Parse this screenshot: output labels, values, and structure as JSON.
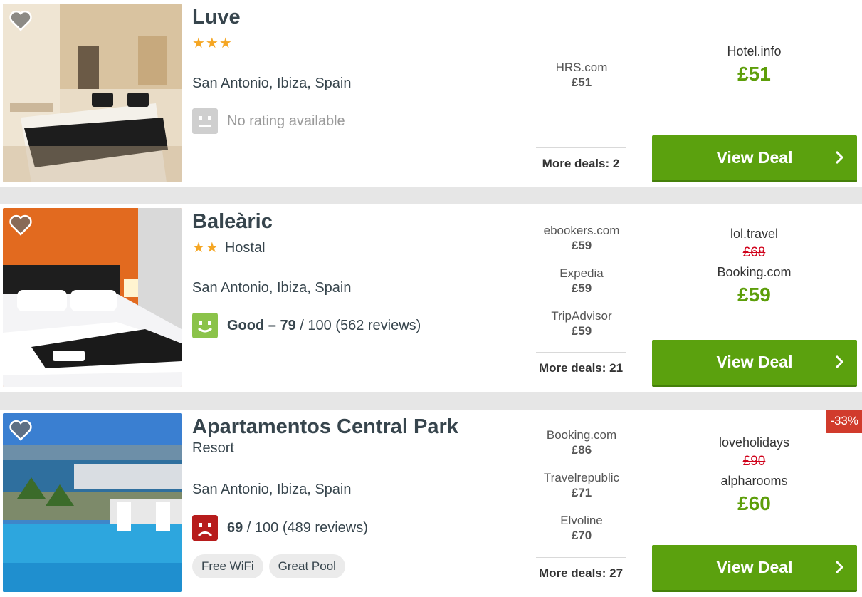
{
  "hotels": [
    {
      "name": "Luve",
      "stars": "★★★",
      "type": "",
      "location": "San Antonio, Ibiza, Spain",
      "rating": {
        "face": "neutral-face-icon",
        "color": "#cfcfcf",
        "score_label": "",
        "score": "",
        "rest": "No rating available"
      },
      "chips": [],
      "alternatives": [
        {
          "site": "HRS.com",
          "price": "£51"
        }
      ],
      "more_deals": "More deals: 2",
      "best": {
        "site": "Hotel.info",
        "old_site": "",
        "old_price": "",
        "price": "£51"
      },
      "button": "View Deal",
      "badge": ""
    },
    {
      "name": "Baleàric",
      "stars": "★★",
      "type": "Hostal",
      "location": "San Antonio, Ibiza, Spain",
      "rating": {
        "face": "smile-face-icon",
        "color": "#8bc34a",
        "score_label": "Good – 79",
        "score": "",
        "rest": " / 100 (562 reviews)"
      },
      "chips": [],
      "alternatives": [
        {
          "site": "ebookers.com",
          "price": "£59"
        },
        {
          "site": "Expedia",
          "price": "£59"
        },
        {
          "site": "TripAdvisor",
          "price": "£59"
        }
      ],
      "more_deals": "More deals: 21",
      "best": {
        "old_site": "lol.travel",
        "old_price": "£68",
        "site": "Booking.com",
        "price": "£59"
      },
      "button": "View Deal",
      "badge": ""
    },
    {
      "name": "Apartamentos Central Park",
      "stars": "",
      "type": "Resort",
      "location": "San Antonio, Ibiza, Spain",
      "rating": {
        "face": "sad-face-icon",
        "color": "#b71c1c",
        "score_label": "69",
        "score": "",
        "rest": " / 100 (489 reviews)"
      },
      "chips": [
        "Free WiFi",
        "Great Pool"
      ],
      "alternatives": [
        {
          "site": "Booking.com",
          "price": "£86"
        },
        {
          "site": "Travelrepublic",
          "price": "£71"
        },
        {
          "site": "Elvoline",
          "price": "£70"
        }
      ],
      "more_deals": "More deals: 27",
      "best": {
        "old_site": "loveholidays",
        "old_price": "£90",
        "site": "alpharooms",
        "price": "£60"
      },
      "button": "View Deal",
      "badge": "-33%"
    }
  ],
  "colors": {
    "deal_green": "#5ba10e",
    "price_green": "#5d9e0a",
    "strike_red": "#d0021b",
    "badge_red": "#d13b2c",
    "star_gold": "#f5a623"
  }
}
